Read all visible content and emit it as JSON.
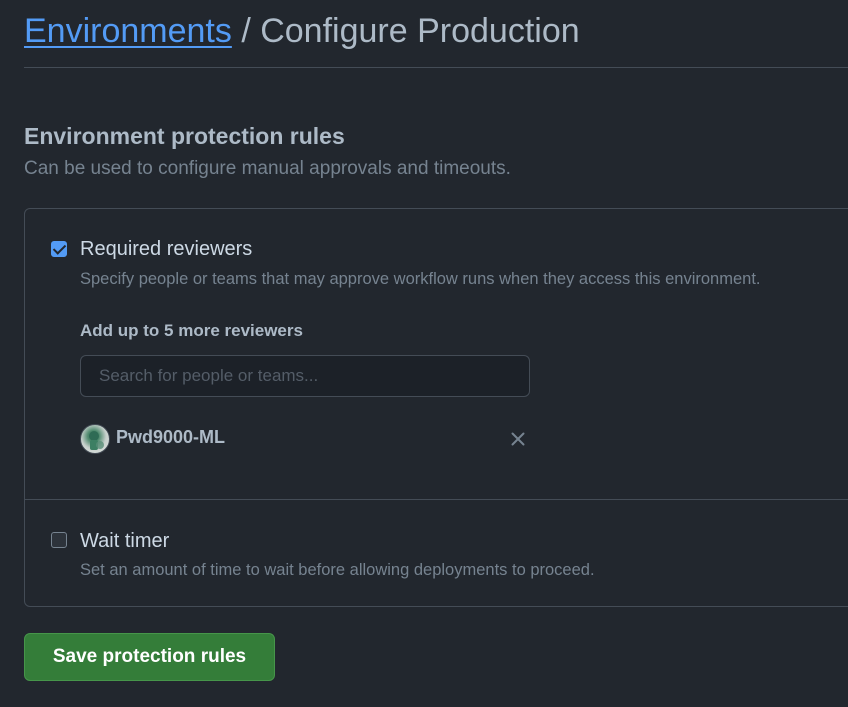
{
  "header": {
    "breadcrumb_link": "Environments",
    "separator": " / ",
    "title": "Configure Production"
  },
  "section": {
    "title": "Environment protection rules",
    "description": "Can be used to configure manual approvals and timeouts."
  },
  "rules": {
    "required_reviewers": {
      "checked": true,
      "title": "Required reviewers",
      "description": "Specify people or teams that may approve workflow runs when they access this environment.",
      "add_label": "Add up to 5 more reviewers",
      "search_placeholder": "Search for people or teams...",
      "reviewers": [
        {
          "name": "Pwd9000-ML",
          "avatar": "avatar-icon"
        }
      ]
    },
    "wait_timer": {
      "checked": false,
      "title": "Wait timer",
      "description": "Set an amount of time to wait before allowing deployments to proceed."
    }
  },
  "actions": {
    "save_label": "Save protection rules"
  },
  "colors": {
    "background": "#22272e",
    "link": "#539bf5",
    "primary_button": "#347d39",
    "checkbox_checked": "#539bf5"
  }
}
